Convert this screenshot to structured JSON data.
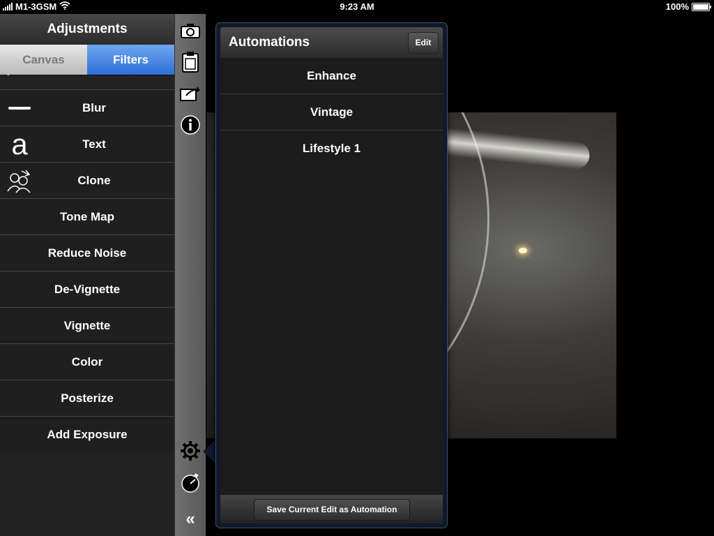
{
  "status_bar": {
    "carrier": "M1-3GSM",
    "time": "9:23 AM",
    "battery": "100%",
    "battery_level": 1.0
  },
  "adjustments": {
    "title": "Adjustments",
    "tabs": [
      {
        "label": "Canvas",
        "selected": false
      },
      {
        "label": "Filters",
        "selected": true
      }
    ],
    "items": [
      {
        "label": "Blur",
        "icon": "blur-icon"
      },
      {
        "label": "Text",
        "icon": "text-icon"
      },
      {
        "label": "Clone",
        "icon": "clone-icon"
      },
      {
        "label": "Tone Map"
      },
      {
        "label": "Reduce Noise"
      },
      {
        "label": "De-Vignette"
      },
      {
        "label": "Vignette"
      },
      {
        "label": "Color"
      },
      {
        "label": "Posterize"
      },
      {
        "label": "Add Exposure"
      }
    ],
    "text_icon_glyph": "a"
  },
  "toolbar": {
    "icons": [
      "camera-icon",
      "clipboard-icon",
      "share-icon",
      "info-icon",
      "gear-icon",
      "stopwatch-icon",
      "collapse-icon"
    ],
    "collapse_glyph": "«"
  },
  "automations": {
    "title": "Automations",
    "edit_label": "Edit",
    "items": [
      "Enhance",
      "Vintage",
      "Lifestyle 1"
    ],
    "save_label": "Save Current Edit as Automation"
  },
  "colors": {
    "selected_tab": "#2d6fd8",
    "panel_bg": "#1f1f1f",
    "popover_border": "#0f1a2c"
  }
}
